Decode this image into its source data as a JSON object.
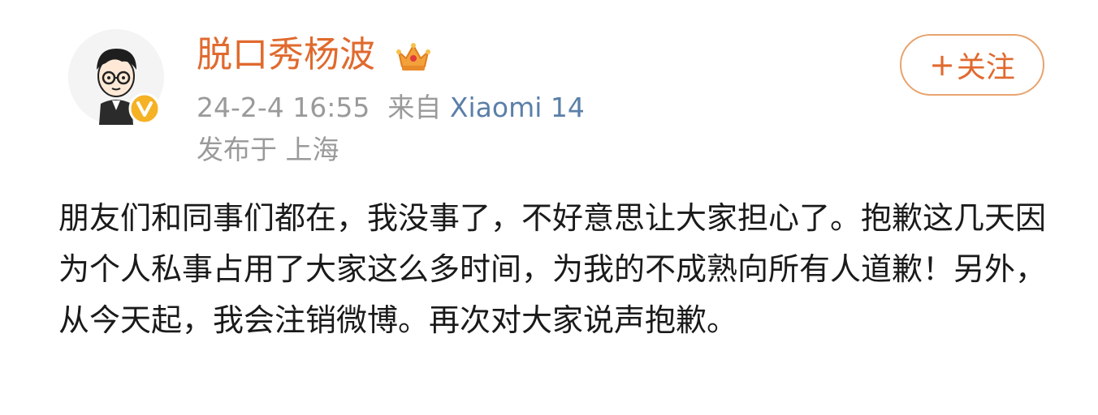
{
  "user": {
    "name": "脱口秀杨波",
    "avatar_icon": "cartoon-avatar",
    "verified_icon": "verified-v-badge",
    "crown_icon": "crown-icon"
  },
  "post": {
    "timestamp": "24-2-4 16:55",
    "source_prefix": "来自",
    "device": "Xiaomi 14",
    "location": "发布于 上海",
    "content": "朋友们和同事们都在，我没事了，不好意思让大家担心了。抱歉这几天因为个人私事占用了大家这么多时间，为我的不成熟向所有人道歉！另外，从今天起，我会注销微博。再次对大家说声抱歉。"
  },
  "follow": {
    "plus": "+",
    "label": "关注"
  },
  "colors": {
    "accent": "#e06a2e",
    "meta": "#9a9a9a",
    "device_link": "#5b7fa8",
    "text": "#1a1a1a"
  }
}
